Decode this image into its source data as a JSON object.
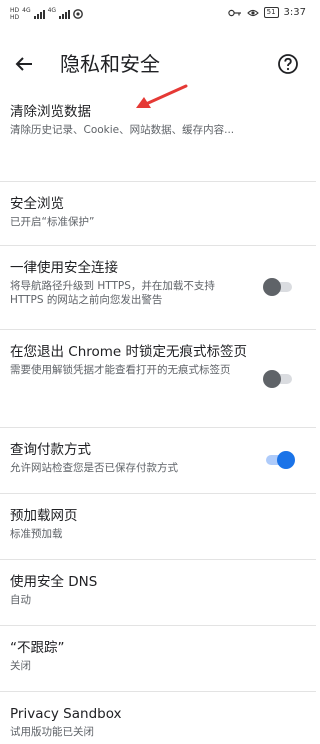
{
  "status_bar": {
    "net_top": "HD",
    "net_bottom": "HD",
    "gen1": "4G",
    "gen2": "4G",
    "battery": "51",
    "time": "3:37"
  },
  "toolbar": {
    "title": "隐私和安全"
  },
  "settings": [
    {
      "title": "清除浏览数据",
      "subtitle": "清除历史记录、Cookie、网站数据、缓存内容..."
    },
    {
      "title": "安全浏览",
      "subtitle": "已开启“标准保护”"
    },
    {
      "title": "一律使用安全连接",
      "subtitle": "将导航路径升级到 HTTPS，并在加载不支持 HTTPS 的网站之前向您发出警告",
      "toggle": false
    },
    {
      "title": "在您退出 Chrome 时锁定无痕式标签页",
      "subtitle": "需要使用解锁凭据才能查看打开的无痕式标签页",
      "toggle": false
    },
    {
      "title": "查询付款方式",
      "subtitle": "允许网站检查您是否已保存付款方式",
      "toggle": true
    },
    {
      "title": "预加载网页",
      "subtitle": "标准预加载"
    },
    {
      "title": "使用安全 DNS",
      "subtitle": "自动"
    },
    {
      "title": "“不跟踪”",
      "subtitle": "关闭"
    },
    {
      "title": "Privacy Sandbox",
      "subtitle": "试用版功能已关闭"
    }
  ],
  "colors": {
    "toggle_on": "#1a73e8",
    "annotation_arrow": "#e53935"
  }
}
